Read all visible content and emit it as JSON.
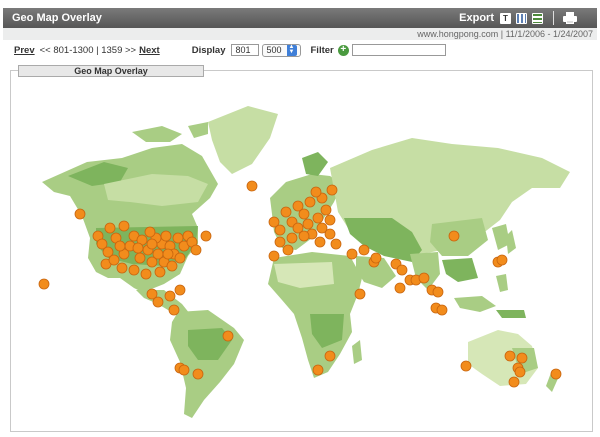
{
  "titlebar": {
    "title": "Geo Map Overlay",
    "export_label": "Export",
    "icons": [
      "text-export-icon",
      "grid-export-icon",
      "spreadsheet-export-icon",
      "printer-icon"
    ]
  },
  "info": {
    "text": "www.hongpong.com  |  11/1/2006 - 1/24/2007"
  },
  "controls": {
    "prev_label": "Prev",
    "range_text": "<< 801-1300 | 1359 >>",
    "next_label": "Next",
    "display_label": "Display",
    "display_start": "801",
    "display_count": "500",
    "filter_label": "Filter",
    "filter_value": ""
  },
  "panel": {
    "tab_label": "Geo Map Overlay"
  },
  "colors": {
    "ocean": "#ffffff",
    "land_light": "#d6e7b7",
    "land_mid": "#a9cd84",
    "land_dark": "#7eb45d",
    "marker": "#f28c1c"
  }
}
